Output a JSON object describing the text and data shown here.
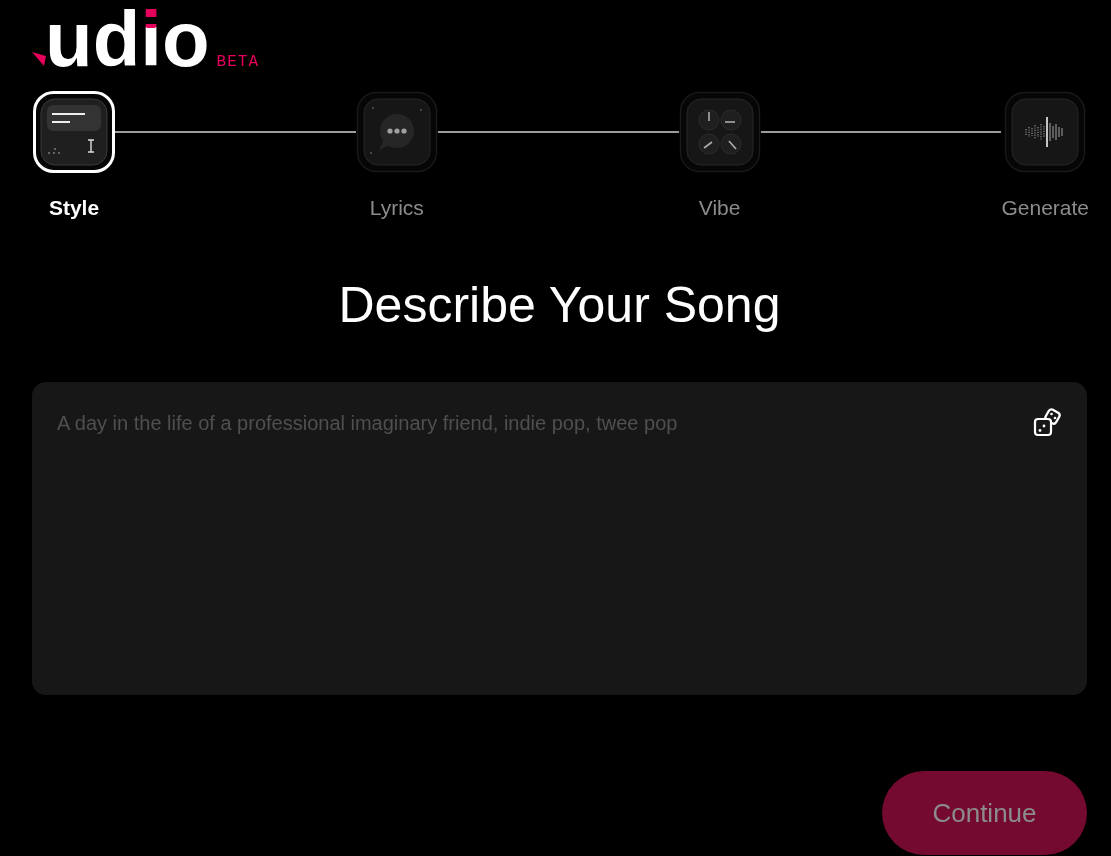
{
  "logo": {
    "wordmark": "udio",
    "badge": "BETA"
  },
  "steps": [
    {
      "label": "Style",
      "selected": true,
      "kind": "style"
    },
    {
      "label": "Lyrics",
      "selected": false,
      "kind": "lyrics"
    },
    {
      "label": "Vibe",
      "selected": false,
      "kind": "vibe"
    },
    {
      "label": "Generate",
      "selected": false,
      "kind": "generate"
    }
  ],
  "heading": "Describe Your Song",
  "prompt": {
    "placeholder": "A day in the life of a professional imaginary friend, indie pop, twee pop"
  },
  "continue_button": {
    "label": "Continue",
    "disabled": true
  }
}
